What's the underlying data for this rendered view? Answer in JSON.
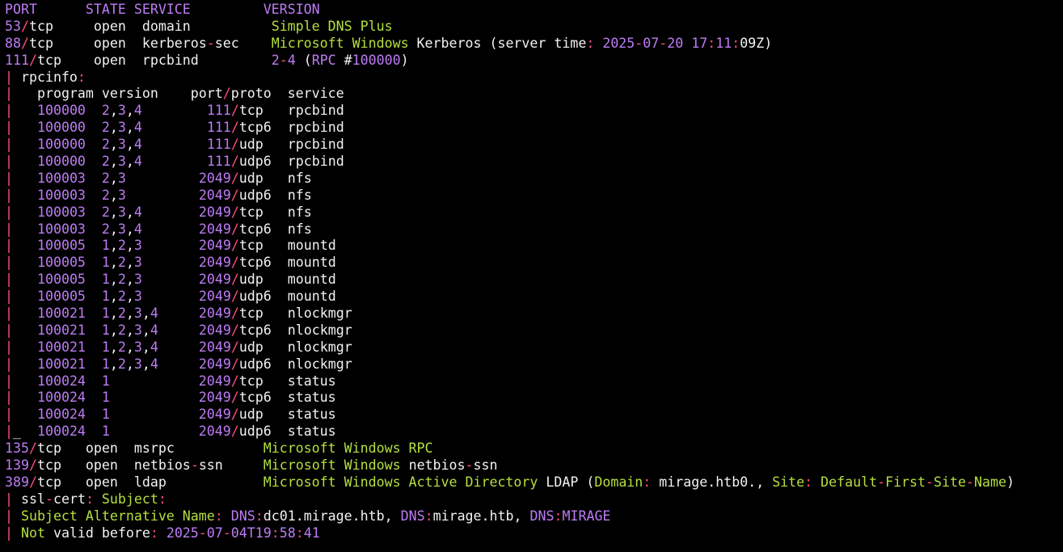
{
  "colors": {
    "background": "#000000",
    "text": "#f2f2f2",
    "number_purple": "#bd7cf5",
    "service_green": "#b5e03e",
    "punct_pink": "#ff4d7a"
  },
  "lines": [
    [
      [
        "PORT      STATE SERVICE         VERSION",
        "num"
      ]
    ],
    [
      [
        "53",
        "num"
      ],
      [
        "/",
        "pink"
      ],
      [
        "tcp     open  domain          ",
        "white"
      ],
      [
        "Simple DNS Plus",
        "green"
      ]
    ],
    [
      [
        "88",
        "num"
      ],
      [
        "/",
        "pink"
      ],
      [
        "tcp     open  kerberos",
        "white"
      ],
      [
        "-",
        "pink"
      ],
      [
        "sec    ",
        "white"
      ],
      [
        "Microsoft Windows ",
        "green"
      ],
      [
        "Kerberos (server time",
        "white"
      ],
      [
        ": ",
        "pink"
      ],
      [
        "2025",
        "num"
      ],
      [
        "-",
        "pink"
      ],
      [
        "07",
        "num"
      ],
      [
        "-",
        "pink"
      ],
      [
        "20 17",
        "num"
      ],
      [
        ":",
        "pink"
      ],
      [
        "11",
        "num"
      ],
      [
        ":",
        "pink"
      ],
      [
        "09Z)",
        "white"
      ]
    ],
    [
      [
        "111",
        "num"
      ],
      [
        "/",
        "pink"
      ],
      [
        "tcp    open  rpcbind         ",
        "white"
      ],
      [
        "2",
        "num"
      ],
      [
        "-",
        "pink"
      ],
      [
        "4",
        "num"
      ],
      [
        " (",
        "white"
      ],
      [
        "RPC ",
        "num"
      ],
      [
        "#",
        "white"
      ],
      [
        "100000",
        "num"
      ],
      [
        ")",
        "white"
      ]
    ],
    [
      [
        "| ",
        "pink"
      ],
      [
        "rpcinfo",
        "white"
      ],
      [
        ":",
        "pink"
      ]
    ],
    [
      [
        "|",
        "pink"
      ],
      [
        "   program version    port",
        "white"
      ],
      [
        "/",
        "pink"
      ],
      [
        "proto  service",
        "white"
      ]
    ],
    [
      [
        "|",
        "pink"
      ],
      [
        "   ",
        "white"
      ],
      [
        "100000  2",
        "num"
      ],
      [
        ",",
        "white"
      ],
      [
        "3",
        "num"
      ],
      [
        ",",
        "white"
      ],
      [
        "4        ",
        "num"
      ],
      [
        "111",
        "num"
      ],
      [
        "/",
        "pink"
      ],
      [
        "tcp   rpcbind",
        "white"
      ]
    ],
    [
      [
        "|",
        "pink"
      ],
      [
        "   ",
        "white"
      ],
      [
        "100000  2",
        "num"
      ],
      [
        ",",
        "white"
      ],
      [
        "3",
        "num"
      ],
      [
        ",",
        "white"
      ],
      [
        "4        ",
        "num"
      ],
      [
        "111",
        "num"
      ],
      [
        "/",
        "pink"
      ],
      [
        "tcp6  rpcbind",
        "white"
      ]
    ],
    [
      [
        "|",
        "pink"
      ],
      [
        "   ",
        "white"
      ],
      [
        "100000  2",
        "num"
      ],
      [
        ",",
        "white"
      ],
      [
        "3",
        "num"
      ],
      [
        ",",
        "white"
      ],
      [
        "4        ",
        "num"
      ],
      [
        "111",
        "num"
      ],
      [
        "/",
        "pink"
      ],
      [
        "udp   rpcbind",
        "white"
      ]
    ],
    [
      [
        "|",
        "pink"
      ],
      [
        "   ",
        "white"
      ],
      [
        "100000  2",
        "num"
      ],
      [
        ",",
        "white"
      ],
      [
        "3",
        "num"
      ],
      [
        ",",
        "white"
      ],
      [
        "4        ",
        "num"
      ],
      [
        "111",
        "num"
      ],
      [
        "/",
        "pink"
      ],
      [
        "udp6  rpcbind",
        "white"
      ]
    ],
    [
      [
        "|",
        "pink"
      ],
      [
        "   ",
        "white"
      ],
      [
        "100003  2",
        "num"
      ],
      [
        ",",
        "white"
      ],
      [
        "3         ",
        "num"
      ],
      [
        "2049",
        "num"
      ],
      [
        "/",
        "pink"
      ],
      [
        "udp   nfs",
        "white"
      ]
    ],
    [
      [
        "|",
        "pink"
      ],
      [
        "   ",
        "white"
      ],
      [
        "100003  2",
        "num"
      ],
      [
        ",",
        "white"
      ],
      [
        "3         ",
        "num"
      ],
      [
        "2049",
        "num"
      ],
      [
        "/",
        "pink"
      ],
      [
        "udp6  nfs",
        "white"
      ]
    ],
    [
      [
        "|",
        "pink"
      ],
      [
        "   ",
        "white"
      ],
      [
        "100003  2",
        "num"
      ],
      [
        ",",
        "white"
      ],
      [
        "3",
        "num"
      ],
      [
        ",",
        "white"
      ],
      [
        "4       ",
        "num"
      ],
      [
        "2049",
        "num"
      ],
      [
        "/",
        "pink"
      ],
      [
        "tcp   nfs",
        "white"
      ]
    ],
    [
      [
        "|",
        "pink"
      ],
      [
        "   ",
        "white"
      ],
      [
        "100003  2",
        "num"
      ],
      [
        ",",
        "white"
      ],
      [
        "3",
        "num"
      ],
      [
        ",",
        "white"
      ],
      [
        "4       ",
        "num"
      ],
      [
        "2049",
        "num"
      ],
      [
        "/",
        "pink"
      ],
      [
        "tcp6  nfs",
        "white"
      ]
    ],
    [
      [
        "|",
        "pink"
      ],
      [
        "   ",
        "white"
      ],
      [
        "100005  1",
        "num"
      ],
      [
        ",",
        "white"
      ],
      [
        "2",
        "num"
      ],
      [
        ",",
        "white"
      ],
      [
        "3       ",
        "num"
      ],
      [
        "2049",
        "num"
      ],
      [
        "/",
        "pink"
      ],
      [
        "tcp   mountd",
        "white"
      ]
    ],
    [
      [
        "|",
        "pink"
      ],
      [
        "   ",
        "white"
      ],
      [
        "100005  1",
        "num"
      ],
      [
        ",",
        "white"
      ],
      [
        "2",
        "num"
      ],
      [
        ",",
        "white"
      ],
      [
        "3       ",
        "num"
      ],
      [
        "2049",
        "num"
      ],
      [
        "/",
        "pink"
      ],
      [
        "tcp6  mountd",
        "white"
      ]
    ],
    [
      [
        "|",
        "pink"
      ],
      [
        "   ",
        "white"
      ],
      [
        "100005  1",
        "num"
      ],
      [
        ",",
        "white"
      ],
      [
        "2",
        "num"
      ],
      [
        ",",
        "white"
      ],
      [
        "3       ",
        "num"
      ],
      [
        "2049",
        "num"
      ],
      [
        "/",
        "pink"
      ],
      [
        "udp   mountd",
        "white"
      ]
    ],
    [
      [
        "|",
        "pink"
      ],
      [
        "   ",
        "white"
      ],
      [
        "100005  1",
        "num"
      ],
      [
        ",",
        "white"
      ],
      [
        "2",
        "num"
      ],
      [
        ",",
        "white"
      ],
      [
        "3       ",
        "num"
      ],
      [
        "2049",
        "num"
      ],
      [
        "/",
        "pink"
      ],
      [
        "udp6  mountd",
        "white"
      ]
    ],
    [
      [
        "|",
        "pink"
      ],
      [
        "   ",
        "white"
      ],
      [
        "100021  1",
        "num"
      ],
      [
        ",",
        "white"
      ],
      [
        "2",
        "num"
      ],
      [
        ",",
        "white"
      ],
      [
        "3",
        "num"
      ],
      [
        ",",
        "white"
      ],
      [
        "4     ",
        "num"
      ],
      [
        "2049",
        "num"
      ],
      [
        "/",
        "pink"
      ],
      [
        "tcp   nlockmgr",
        "white"
      ]
    ],
    [
      [
        "|",
        "pink"
      ],
      [
        "   ",
        "white"
      ],
      [
        "100021  1",
        "num"
      ],
      [
        ",",
        "white"
      ],
      [
        "2",
        "num"
      ],
      [
        ",",
        "white"
      ],
      [
        "3",
        "num"
      ],
      [
        ",",
        "white"
      ],
      [
        "4     ",
        "num"
      ],
      [
        "2049",
        "num"
      ],
      [
        "/",
        "pink"
      ],
      [
        "tcp6  nlockmgr",
        "white"
      ]
    ],
    [
      [
        "|",
        "pink"
      ],
      [
        "   ",
        "white"
      ],
      [
        "100021  1",
        "num"
      ],
      [
        ",",
        "white"
      ],
      [
        "2",
        "num"
      ],
      [
        ",",
        "white"
      ],
      [
        "3",
        "num"
      ],
      [
        ",",
        "white"
      ],
      [
        "4     ",
        "num"
      ],
      [
        "2049",
        "num"
      ],
      [
        "/",
        "pink"
      ],
      [
        "udp   nlockmgr",
        "white"
      ]
    ],
    [
      [
        "|",
        "pink"
      ],
      [
        "   ",
        "white"
      ],
      [
        "100021  1",
        "num"
      ],
      [
        ",",
        "white"
      ],
      [
        "2",
        "num"
      ],
      [
        ",",
        "white"
      ],
      [
        "3",
        "num"
      ],
      [
        ",",
        "white"
      ],
      [
        "4     ",
        "num"
      ],
      [
        "2049",
        "num"
      ],
      [
        "/",
        "pink"
      ],
      [
        "udp6  nlockmgr",
        "white"
      ]
    ],
    [
      [
        "|",
        "pink"
      ],
      [
        "   ",
        "white"
      ],
      [
        "100024  1           ",
        "num"
      ],
      [
        "2049",
        "num"
      ],
      [
        "/",
        "pink"
      ],
      [
        "tcp   status",
        "white"
      ]
    ],
    [
      [
        "|",
        "pink"
      ],
      [
        "   ",
        "white"
      ],
      [
        "100024  1           ",
        "num"
      ],
      [
        "2049",
        "num"
      ],
      [
        "/",
        "pink"
      ],
      [
        "tcp6  status",
        "white"
      ]
    ],
    [
      [
        "|",
        "pink"
      ],
      [
        "   ",
        "white"
      ],
      [
        "100024  1           ",
        "num"
      ],
      [
        "2049",
        "num"
      ],
      [
        "/",
        "pink"
      ],
      [
        "udp   status",
        "white"
      ]
    ],
    [
      [
        "|",
        "pink"
      ],
      [
        "_  ",
        "white"
      ],
      [
        "100024  1           ",
        "num"
      ],
      [
        "2049",
        "num"
      ],
      [
        "/",
        "pink"
      ],
      [
        "udp6  status",
        "white"
      ]
    ],
    [
      [
        "135",
        "num"
      ],
      [
        "/",
        "pink"
      ],
      [
        "tcp   open  msrpc           ",
        "white"
      ],
      [
        "Microsoft Windows RPC",
        "green"
      ]
    ],
    [
      [
        "139",
        "num"
      ],
      [
        "/",
        "pink"
      ],
      [
        "tcp   open  netbios",
        "white"
      ],
      [
        "-",
        "pink"
      ],
      [
        "ssn     ",
        "white"
      ],
      [
        "Microsoft Windows ",
        "green"
      ],
      [
        "netbios",
        "white"
      ],
      [
        "-",
        "pink"
      ],
      [
        "ssn",
        "white"
      ]
    ],
    [
      [
        "389",
        "num"
      ],
      [
        "/",
        "pink"
      ],
      [
        "tcp   open  ldap            ",
        "white"
      ],
      [
        "Microsoft Windows Active Directory ",
        "green"
      ],
      [
        "LDAP (",
        "white"
      ],
      [
        "Domain",
        "green"
      ],
      [
        ": ",
        "pink"
      ],
      [
        "mirage",
        "white"
      ],
      [
        ".",
        "white"
      ],
      [
        "htb0",
        "white"
      ],
      [
        ".,",
        "white"
      ],
      [
        " ",
        "white"
      ],
      [
        "Site",
        "green"
      ],
      [
        ": ",
        "pink"
      ],
      [
        "Default",
        "green"
      ],
      [
        "-",
        "pink"
      ],
      [
        "First",
        "green"
      ],
      [
        "-",
        "pink"
      ],
      [
        "Site",
        "green"
      ],
      [
        "-",
        "pink"
      ],
      [
        "Name",
        "green"
      ],
      [
        ")",
        "white"
      ]
    ],
    [
      [
        "| ",
        "pink"
      ],
      [
        "ssl",
        "white"
      ],
      [
        "-",
        "pink"
      ],
      [
        "cert",
        "white"
      ],
      [
        ": ",
        "pink"
      ],
      [
        "Subject",
        "green"
      ],
      [
        ":",
        "pink"
      ]
    ],
    [
      [
        "| ",
        "pink"
      ],
      [
        "Subject Alternative Name",
        "green"
      ],
      [
        ": ",
        "pink"
      ],
      [
        "DNS",
        "num"
      ],
      [
        ":",
        "pink"
      ],
      [
        "dc01",
        "white"
      ],
      [
        ".",
        "white"
      ],
      [
        "mirage",
        "white"
      ],
      [
        ".",
        "white"
      ],
      [
        "htb, ",
        "white"
      ],
      [
        "DNS",
        "num"
      ],
      [
        ":",
        "pink"
      ],
      [
        "mirage",
        "white"
      ],
      [
        ".",
        "white"
      ],
      [
        "htb, ",
        "white"
      ],
      [
        "DNS",
        "num"
      ],
      [
        ":",
        "pink"
      ],
      [
        "MIRAGE",
        "num"
      ]
    ],
    [
      [
        "| ",
        "pink"
      ],
      [
        "Not ",
        "green"
      ],
      [
        "valid before",
        "white"
      ],
      [
        ": ",
        "pink"
      ],
      [
        "2025",
        "num"
      ],
      [
        "-",
        "pink"
      ],
      [
        "07",
        "num"
      ],
      [
        "-",
        "pink"
      ],
      [
        "04T19",
        "num"
      ],
      [
        ":",
        "pink"
      ],
      [
        "58",
        "num"
      ],
      [
        ":",
        "pink"
      ],
      [
        "41",
        "num"
      ]
    ]
  ]
}
